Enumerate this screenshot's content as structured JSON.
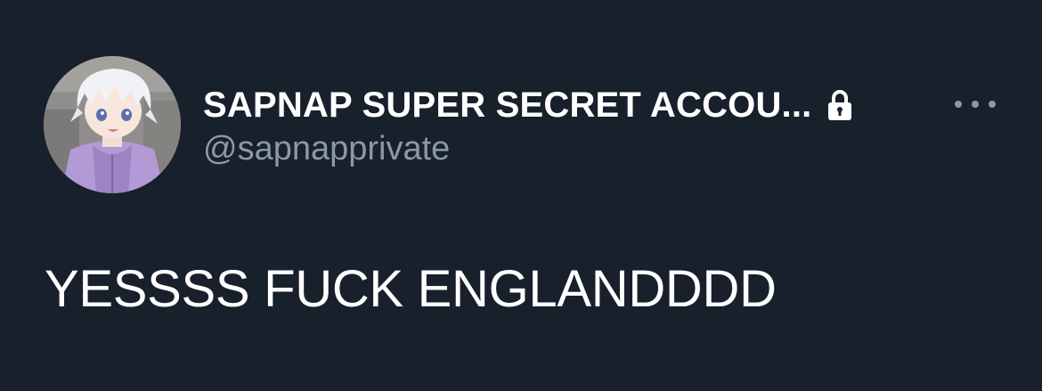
{
  "author": {
    "display_name": "SAPNAP SUPER SECRET ACCOU...",
    "handle": "@sapnapprivate",
    "avatar_icon": "anime-avatar",
    "protected_icon": "lock-icon"
  },
  "actions": {
    "more_icon": "more-icon"
  },
  "tweet": {
    "text": "YESSSS FUCK ENGLANDDDD"
  },
  "colors": {
    "background": "#17202b",
    "text_primary": "#ffffff",
    "text_secondary": "#8b98a5"
  }
}
